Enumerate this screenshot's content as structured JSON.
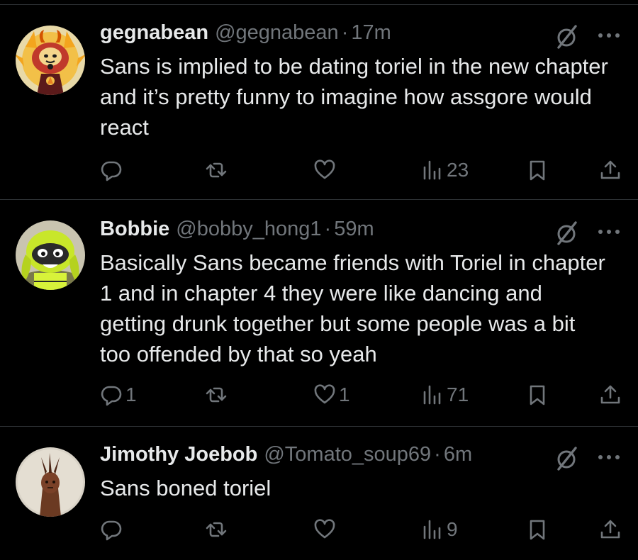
{
  "colors": {
    "background": "#000000",
    "text_primary": "#e7e9ea",
    "text_secondary": "#71767b",
    "divider": "#2f3336"
  },
  "tweets": [
    {
      "name": "gegnabean",
      "handle": "@gegnabean",
      "separator": "·",
      "time": "17m",
      "text": "Sans is implied to be dating toriel in the new chapter and it’s pretty funny to imagine how assgore would react",
      "reply_count": "",
      "retweet_count": "",
      "like_count": "",
      "view_count": "23",
      "avatar_icon": "demon-sun-character-avatar"
    },
    {
      "name": "Bobbie",
      "handle": "@bobby_hong1",
      "separator": "·",
      "time": "59m",
      "text": "Basically Sans became friends with Toriel in chapter 1 and in chapter 4 they were like dancing and getting drunk together but some people was a bit too offended by that so yeah",
      "reply_count": "1",
      "retweet_count": "",
      "like_count": "1",
      "view_count": "71",
      "avatar_icon": "green-squid-character-avatar"
    },
    {
      "name": "Jimothy Joebob",
      "handle": "@Tomato_soup69",
      "separator": "·",
      "time": "6m",
      "text": "Sans boned toriel",
      "reply_count": "",
      "retweet_count": "",
      "like_count": "",
      "view_count": "9",
      "avatar_icon": "horned-figure-avatar"
    }
  ],
  "icons": {
    "grok": "grok-slash-icon",
    "more": "more-dots-icon",
    "reply": "reply-bubble-icon",
    "retweet": "retweet-icon",
    "like": "heart-icon",
    "views": "views-bar-icon",
    "bookmark": "bookmark-icon",
    "share": "share-icon"
  }
}
